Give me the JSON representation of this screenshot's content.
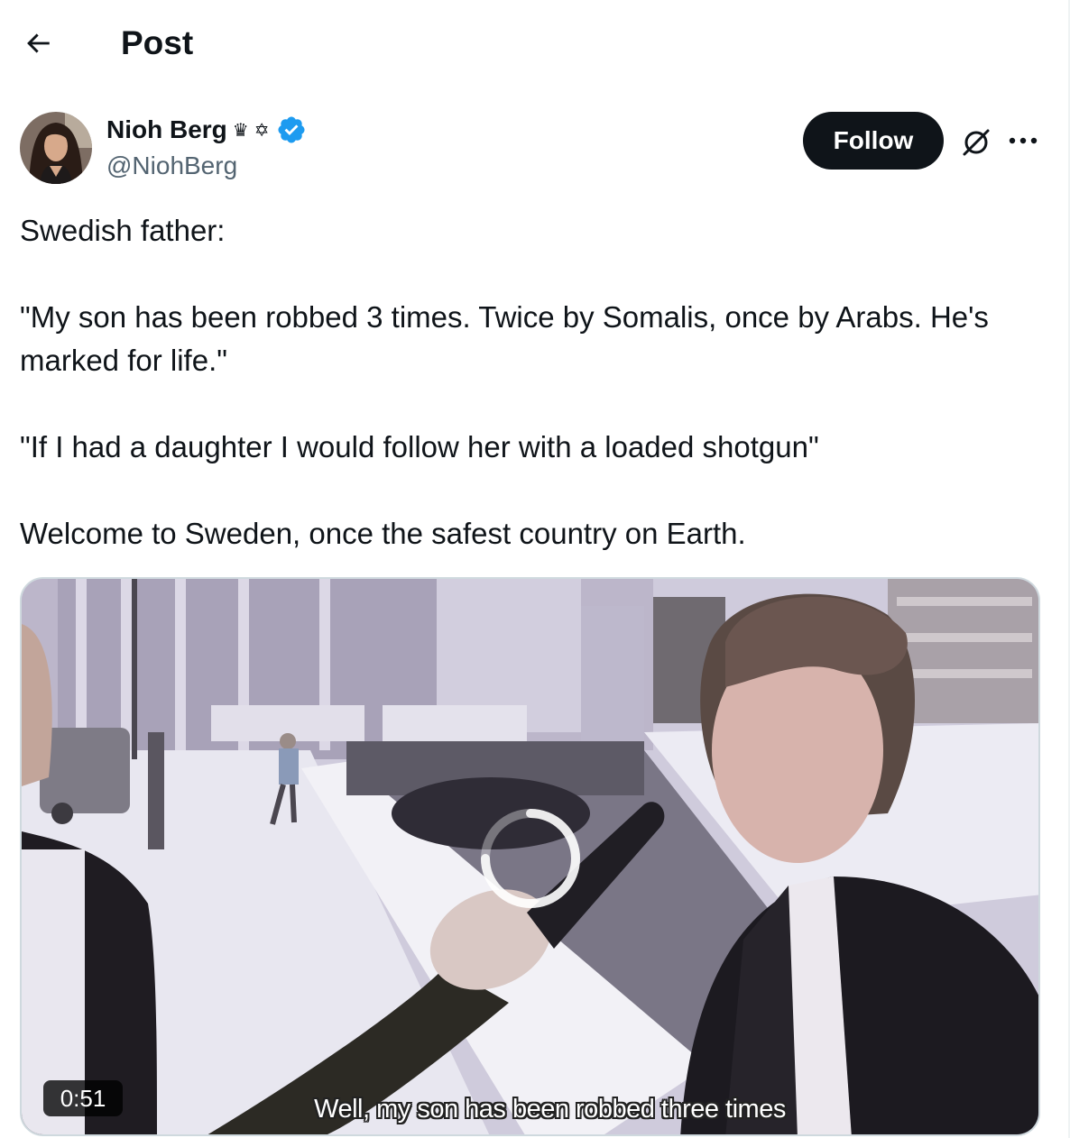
{
  "header": {
    "title": "Post",
    "back_icon": "arrow-left-icon"
  },
  "author": {
    "display_name": "Nioh Berg",
    "name_emojis": [
      "♛",
      "✡"
    ],
    "verified": true,
    "handle": "@NiohBerg",
    "avatar_icon": "profile-photo"
  },
  "actions": {
    "follow_label": "Follow",
    "grok_icon": "grok-icon",
    "more_icon": "more-horizontal-icon"
  },
  "tweet": {
    "paragraphs": [
      "Swedish father:",
      "\"My son has been robbed 3 times. Twice by Somalis, once by Arabs. He's marked for life.\"",
      "\"If I had a daughter I would follow her with a loaded shotgun\"",
      "Welcome to Sweden, once the safest country on Earth."
    ]
  },
  "media": {
    "type": "video",
    "duration": "0:51",
    "subtitle": "Well, my son has been robbed three times",
    "loading_icon": "loading-spinner-icon"
  },
  "colors": {
    "text_primary": "#0f1419",
    "text_secondary": "#536471",
    "verified_blue": "#1d9bf0",
    "follow_bg": "#0f1419",
    "border": "#cfd9de"
  }
}
